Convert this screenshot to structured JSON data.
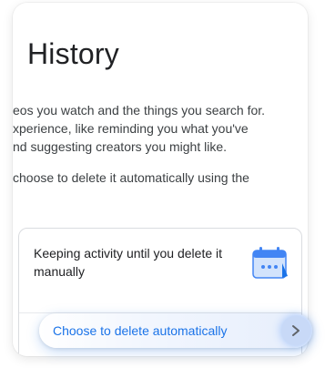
{
  "page": {
    "title": "History"
  },
  "description": {
    "line1": "eos you watch and the things you search for.",
    "line2": "xperience, like reminding you what you've",
    "line3": "nd suggesting creators you might like.",
    "line4": "choose to delete it automatically using the"
  },
  "activity_status": {
    "text": "Keeping activity until you delete it manually",
    "icon": "calendar-icon"
  },
  "auto_delete": {
    "label": "Choose to delete automatically",
    "icon": "chevron-right-icon"
  },
  "colors": {
    "accent": "#1a73e8",
    "calendar_blue": "#4285f4",
    "calendar_light": "#d2e3fc",
    "chevron_bg": "#c8d9f7"
  }
}
